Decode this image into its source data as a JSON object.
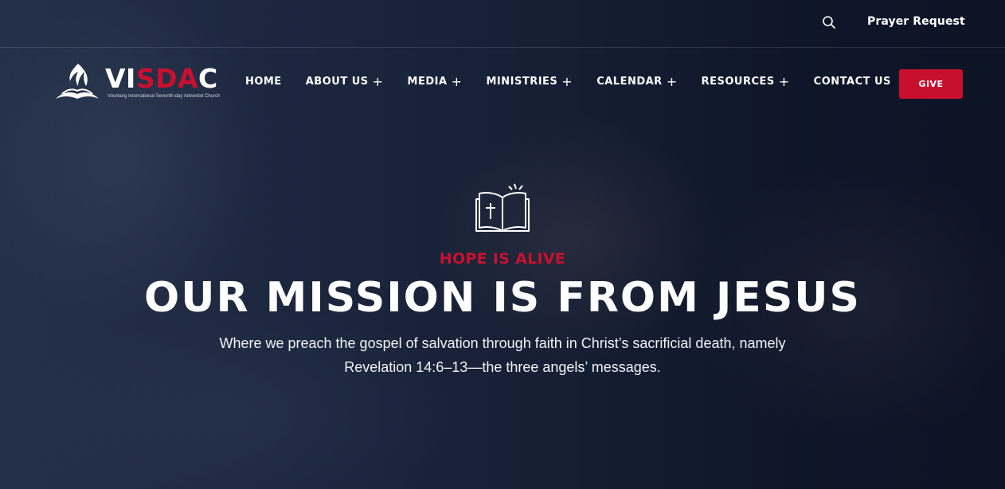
{
  "topbar": {
    "search_icon": "search-icon",
    "prayer_request": "Prayer Request"
  },
  "logo": {
    "text_white_1": "VI",
    "text_red": "SDA",
    "text_white_2": "C",
    "tagline": "Voorburg International Seventh-day Adventist Church",
    "icon": "adventist-flame-book-icon"
  },
  "nav": {
    "items": [
      {
        "label": "HOME",
        "has_submenu": false
      },
      {
        "label": "ABOUT US",
        "has_submenu": true
      },
      {
        "label": "MEDIA",
        "has_submenu": true
      },
      {
        "label": "MINISTRIES",
        "has_submenu": true
      },
      {
        "label": "CALENDAR",
        "has_submenu": true
      },
      {
        "label": "RESOURCES",
        "has_submenu": true
      },
      {
        "label": "CONTACT US",
        "has_submenu": false
      }
    ],
    "submenu_glyph": "+",
    "give_label": "GIVE"
  },
  "hero": {
    "icon": "open-bible-cross-icon",
    "kicker": "HOPE IS ALIVE",
    "title": "OUR MISSION IS FROM JESUS",
    "text_line_1": "Where we preach the gospel of salvation through faith in Christ’s sacrificial death, namely",
    "text_line_2": "Revelation 14:6–13—the three angels’ messages."
  },
  "colors": {
    "accent": "#c8102e",
    "text": "#ffffff",
    "overlay": "#0a1226"
  }
}
